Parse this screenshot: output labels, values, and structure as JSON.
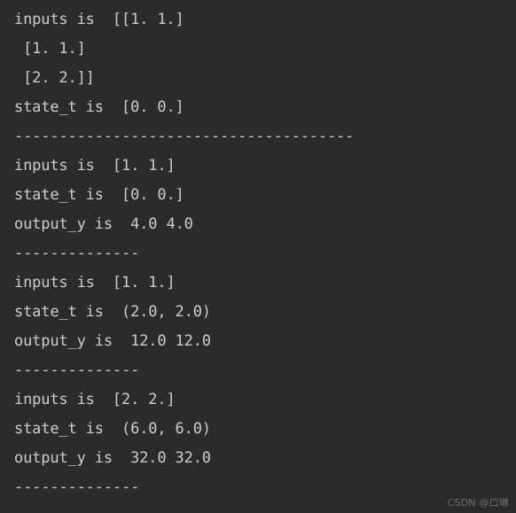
{
  "terminal": {
    "background_color": "#2b2b2b",
    "text_color": "#c9ccd1",
    "lines": [
      {
        "text": "inputs is  [[1. 1.]",
        "type": "output"
      },
      {
        "text": " [1. 1.]",
        "type": "output"
      },
      {
        "text": " [2. 2.]]",
        "type": "output"
      },
      {
        "text": "state_t is  [0. 0.]",
        "type": "output"
      },
      {
        "text": "--------------------------------------",
        "type": "separator"
      },
      {
        "text": "inputs is  [1. 1.]",
        "type": "output"
      },
      {
        "text": "state_t is  [0. 0.]",
        "type": "output"
      },
      {
        "text": "output_y is  4.0 4.0",
        "type": "output"
      },
      {
        "text": "--------------",
        "type": "separator"
      },
      {
        "text": "inputs is  [1. 1.]",
        "type": "output"
      },
      {
        "text": "state_t is  (2.0, 2.0)",
        "type": "output"
      },
      {
        "text": "output_y is  12.0 12.0",
        "type": "output"
      },
      {
        "text": "--------------",
        "type": "separator"
      },
      {
        "text": "inputs is  [2. 2.]",
        "type": "output"
      },
      {
        "text": "state_t is  (6.0, 6.0)",
        "type": "output"
      },
      {
        "text": "output_y is  32.0 32.0",
        "type": "output"
      },
      {
        "text": "--------------",
        "type": "separator"
      }
    ]
  },
  "watermark": {
    "text": "CSDN @口琳",
    "color": "#6e6e6e"
  }
}
